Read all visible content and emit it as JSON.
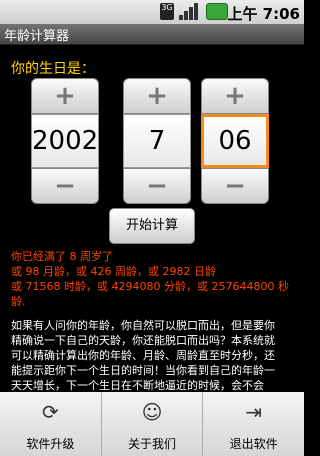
{
  "status": {
    "time": "上午 7:06",
    "network": "3G"
  },
  "app": {
    "title": "年龄计算器"
  },
  "prompt": "你的生日是：",
  "pickers": [
    {
      "value": "2002",
      "plus": "+",
      "minus": "−"
    },
    {
      "value": "7",
      "plus": "+",
      "minus": "−"
    },
    {
      "value": "06",
      "plus": "+",
      "minus": "−"
    }
  ],
  "start_button": "开始计算",
  "result": [
    "你已经满了 8 周岁了",
    "或 98 月龄，或 426 周龄，或 2982 日龄",
    "或 71568 时龄，或 4294080 分龄，或 257644800 秒",
    "龄."
  ],
  "info": [
    "如果有人问你的年龄，你自然可以脱口而出，但是要你",
    "精确说一下自己的天龄，你还能脱口而出吗？本系统就",
    "可以精确计算出你的年龄、月龄、周龄直至时分秒，还",
    "能提示距你下一个生日的时间！当你看到自己的年龄一",
    "天天增长，下一个生日在不断地逼近的时候，会不会"
  ],
  "menu": [
    {
      "label": "软件升级",
      "icon": "refresh-icon",
      "glyph": "⟳"
    },
    {
      "label": "关于我们",
      "icon": "smiley-icon",
      "glyph": "☺"
    },
    {
      "label": "退出软件",
      "icon": "exit-icon",
      "glyph": "⇥"
    }
  ]
}
